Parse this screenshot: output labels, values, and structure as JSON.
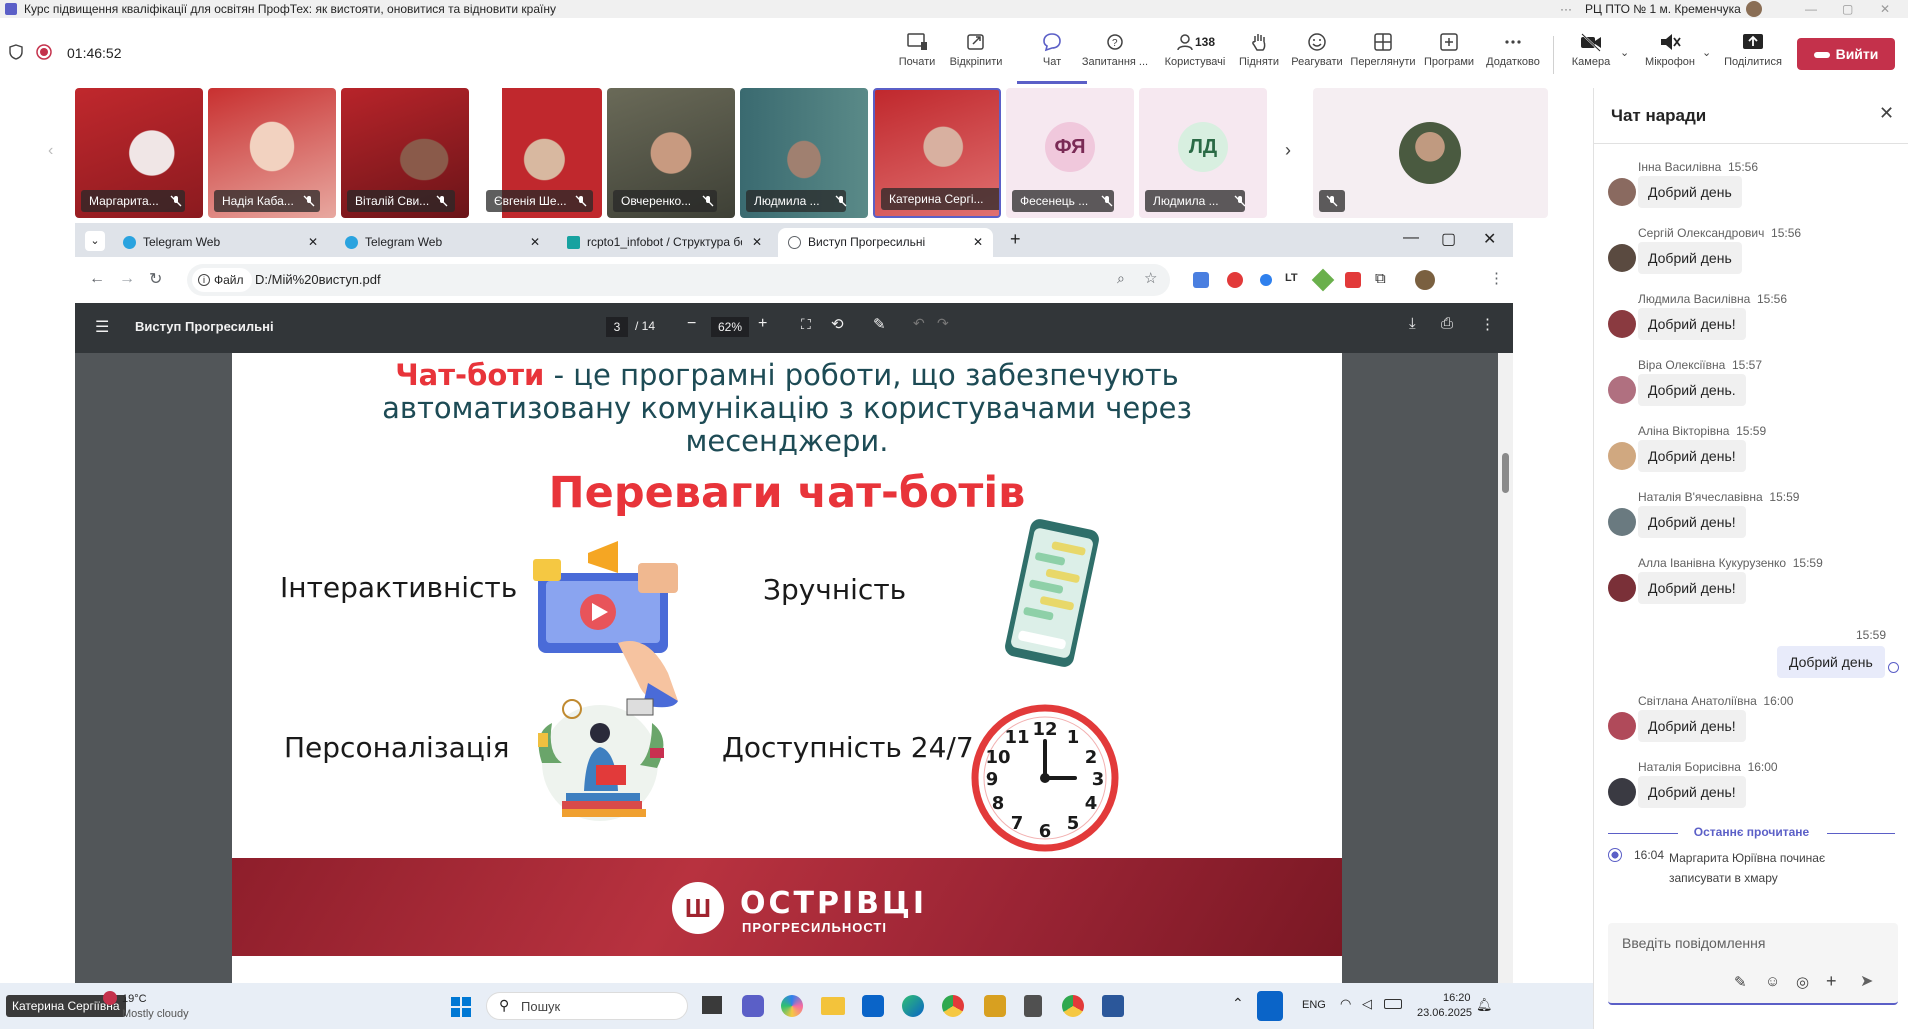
{
  "window": {
    "title": "Курс підвищення кваліфікації для освітян ПрофТех: як вистояти, оновитися та відновити країну",
    "org": "РЦ ПТО № 1 м. Кременчука"
  },
  "meeting": {
    "timer": "01:46:52",
    "toolbar": {
      "start": "Почати",
      "pin": "Відкріпити",
      "chat": "Чат",
      "qa": "Запитання ...",
      "users_count": "138",
      "users": "Користувачі",
      "raise": "Підняти",
      "react": "Реагувати",
      "view": "Переглянути",
      "apps": "Програми",
      "more": "Додатково",
      "camera": "Камера",
      "mic": "Мікрофон",
      "share": "Поділитися",
      "leave": "Вийти"
    }
  },
  "participants": [
    {
      "name": "Маргарита..."
    },
    {
      "name": "Надія Каба..."
    },
    {
      "name": "Віталій Сви..."
    },
    {
      "name": "Євгенія Ше..."
    },
    {
      "name": "Овчеренко..."
    },
    {
      "name": "Людмила ..."
    },
    {
      "name": "Катерина Сергі..."
    },
    {
      "name": "Фесенець ...",
      "initials": "ФЯ"
    },
    {
      "name": "Людмила ...",
      "initials": "ЛД"
    }
  ],
  "browser": {
    "tabs": [
      {
        "label": "Telegram Web"
      },
      {
        "label": "Telegram Web"
      },
      {
        "label": "rcpto1_infobot / Структура бот"
      },
      {
        "label": "Виступ Прогресильні"
      }
    ],
    "file_chip": "Файл",
    "url": "D:/Мій%20виступ.pdf"
  },
  "pdf": {
    "doc_title": "Виступ Прогресильні",
    "page_current": "3",
    "page_total": "/ 14",
    "zoom": "62%"
  },
  "slide": {
    "intro_highlight": "Чат-боти",
    "intro_line1": " - це програмні роботи, що забезпечують",
    "intro_line2": "автоматизовану комунікацію з користувачами через",
    "intro_line3": "месенджери.",
    "heading": "Переваги чат-ботів",
    "benefits": [
      "Інтерактивність",
      "Зручність",
      "Персоналізація",
      "Доступність 24/7"
    ],
    "banner_line1": "ОСТРІВЦІ",
    "banner_line2": "ПРОГРЕСИЛЬНОСТІ"
  },
  "chat": {
    "title": "Чат наради",
    "messages": [
      {
        "author": "Інна Василівна",
        "time": "15:56",
        "text": "Добрий день"
      },
      {
        "author": "Сергій Олександрович",
        "time": "15:56",
        "text": "Добрий день"
      },
      {
        "author": "Людмила Василівна",
        "time": "15:56",
        "text": "Добрий день!"
      },
      {
        "author": "Віра Олексіївна",
        "time": "15:57",
        "text": "Добрий день."
      },
      {
        "author": "Аліна Вікторівна",
        "time": "15:59",
        "text": "Добрий день!"
      },
      {
        "author": "Наталія В'ячеславівна",
        "time": "15:59",
        "text": "Добрий день!"
      },
      {
        "author": "Алла Іванівна Кукурузенко",
        "time": "15:59",
        "text": "Добрий день!"
      }
    ],
    "own_message": {
      "time": "15:59",
      "text": "Добрий день"
    },
    "messages2": [
      {
        "author": "Світлана Анатоліївна",
        "time": "16:00",
        "text": "Добрий день!"
      },
      {
        "author": "Наталія Борисівна",
        "time": "16:00",
        "text": "Добрий день!"
      }
    ],
    "last_read": "Останнє прочитане",
    "system": {
      "time": "16:04",
      "text": "Маргарита Юріївна починає записувати в хмару"
    },
    "compose_placeholder": "Введіть повідомлення"
  },
  "taskbar": {
    "presenter": "Катерина Сергіївна",
    "temp": "19°C",
    "weather": "Mostly cloudy",
    "search": "Пошук",
    "lang": "ENG",
    "time": "16:20",
    "date": "23.06.2025"
  },
  "colors": {
    "teams_purple": "#5b5fc7",
    "leave_red": "#c4314b",
    "slide_red": "#e8343a",
    "slide_teal": "#1d4b55"
  }
}
